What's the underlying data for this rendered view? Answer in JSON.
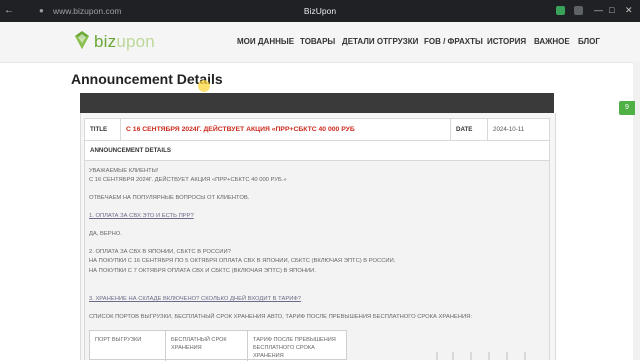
{
  "browser": {
    "url": "www.bizupon.com",
    "window_title": "BizUpon",
    "icons": [
      "back-arrow-icon",
      "lock-icon",
      "shield-extension-icon",
      "extension-icon",
      "minimize-icon",
      "maximize-icon",
      "close-icon"
    ]
  },
  "site": {
    "logo": {
      "part1": "biz",
      "part2": "upon"
    },
    "menu": [
      "МОИ ДАННЫЕ",
      "ТОВАРЫ",
      "ДЕТАЛИ ОТГРУЗКИ",
      "FOB / ФРАХТЫ",
      "ИСТОРИЯ",
      "ВАЖНОЕ",
      "БЛОГ"
    ],
    "accent_color": "#6aa836"
  },
  "page": {
    "heading": "Announcement Details",
    "title_label": "TITLE",
    "title_value": "С 16 СЕНТЯБРЯ 2024Г. ДЕЙСТВУЕТ АКЦИЯ «ПРР+СБКТС 40 000 РУБ",
    "date_label": "DATE",
    "date_value": "2024-10-11",
    "details_label": "ANNOUNCEMENT DETAILS",
    "title_color": "#cc2a1c"
  },
  "content": {
    "greeting": "УВАЖАЕМЫЕ КЛИЕНТЫ!",
    "intro": "С 16 СЕНТЯБРЯ 2024Г. ДЕЙСТВУЕТ АКЦИЯ «ПРР+СБКТС 40 000 РУБ.»",
    "faq_intro": "ОТВЕЧАЕМ НА ПОПУЛЯРНЫЕ ВОПРОСЫ ОТ КЛИЕНТОВ.",
    "q1": "1. ОПЛАТА ЗА СВХ ЭТО И ЕСТЬ ПРР?",
    "a1": "ДА, ВЕРНО.",
    "q2": "2. ОПЛАТА ЗА СВХ В ЯПОНИИ, СБКТС В РОССИИ?",
    "a2_line1": "НА ПОКУПКИ С 16 СЕНТЯБРЯ ПО 5 ОКТЯБРЯ ОПЛАТА СВХ В ЯПОНИИ, СБКТС (ВКЛЮЧАЯ ЭПТС) В РОССИИ.",
    "a2_line2": "НА ПОКУПКИ С 7 ОКТЯБРЯ ОПЛАТА СВХ И СБКТС (ВКЛЮЧАЯ ЭПТС) В ЯПОНИИ.",
    "q3": "3. ХРАНЕНИЕ НА СКЛАДЕ ВКЛЮЧЕНО? СКОЛЬКО ДНЕЙ ВХОДИТ В ТАРИФ?",
    "a3": "СПИСОК ПОРТОВ ВЫГРУЗКИ, БЕСПЛАТНЫЙ СРОК ХРАНЕНИЯ АВТО, ТАРИФ ПОСЛЕ ПРЕВЫШЕНИЯ БЕСПЛАТНОГО СРОКА ХРАНЕНИЯ:",
    "table_headers": [
      "ПОРТ ВЫГРУЗКИ",
      "БЕСПЛАТНЫЙ СРОК ХРАНЕНИЯ",
      "ТАРИФ ПОСЛЕ ПРЕВЫШЕНИЯ БЕСПЛАТНОГО СРОКА ХРАНЕНИЯ"
    ]
  },
  "widget": {
    "badge": "9",
    "color": "#4fb045"
  }
}
